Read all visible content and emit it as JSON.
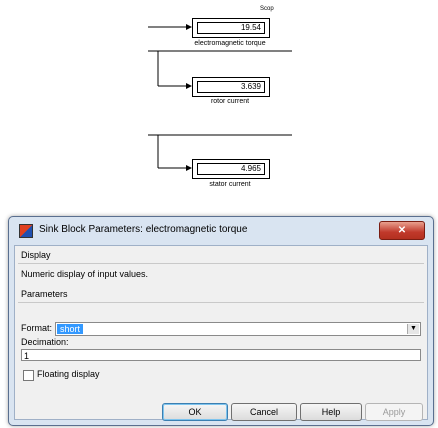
{
  "diagram": {
    "scope_label": "Scop",
    "blocks": [
      {
        "value": "19.54",
        "label": "electromagnetic torque"
      },
      {
        "value": "3.639",
        "label": "rotor current"
      },
      {
        "value": "4.965",
        "label": "stator current"
      }
    ]
  },
  "dialog": {
    "title": "Sink Block Parameters: electromagnetic torque",
    "close_label": "✕",
    "display_group": "Display",
    "description": "Numeric display of input values.",
    "parameters_group": "Parameters",
    "format_label": "Format:",
    "format_value": "short",
    "decimation_label": "Decimation:",
    "decimation_value": "1",
    "floating_label": "Floating display",
    "floating_checked": false,
    "buttons": {
      "ok": "OK",
      "cancel": "Cancel",
      "help": "Help",
      "apply": "Apply"
    }
  }
}
